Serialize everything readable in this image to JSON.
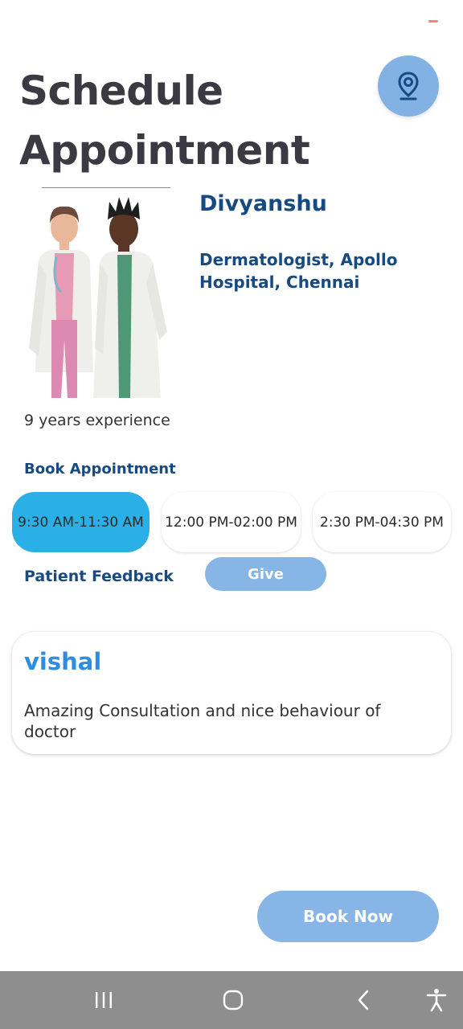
{
  "header": {
    "title": "Schedule Appointment",
    "location_icon": "location-pin-icon"
  },
  "doctor": {
    "name": "Divyanshu",
    "specialty": "Dermatologist, Apollo Hospital, Chennai",
    "experience": "9 years experience",
    "photo_alt": "doctors-illustration"
  },
  "booking": {
    "label": "Book Appointment",
    "slots": [
      {
        "label": "9:30 AM-11:30 AM",
        "selected": true
      },
      {
        "label": "12:00 PM-02:00 PM",
        "selected": false
      },
      {
        "label": "2:30 PM-04:30 PM",
        "selected": false
      }
    ]
  },
  "feedback": {
    "label": "Patient Feedback",
    "give_label": "Give",
    "items": [
      {
        "author": "vishal",
        "text": "Amazing Consultation and nice behaviour of doctor"
      }
    ]
  },
  "actions": {
    "book_now_label": "Book Now"
  },
  "nav": {
    "icons": [
      "recent-apps-icon",
      "home-icon",
      "back-icon",
      "accessibility-icon"
    ]
  },
  "colors": {
    "primary_text": "#184a82",
    "accent_blue": "#86b5e6",
    "selected_slot": "#2ab0e6",
    "feedback_author": "#2d8de3",
    "title": "#3b3a43",
    "navbar": "#8e8e8e"
  }
}
